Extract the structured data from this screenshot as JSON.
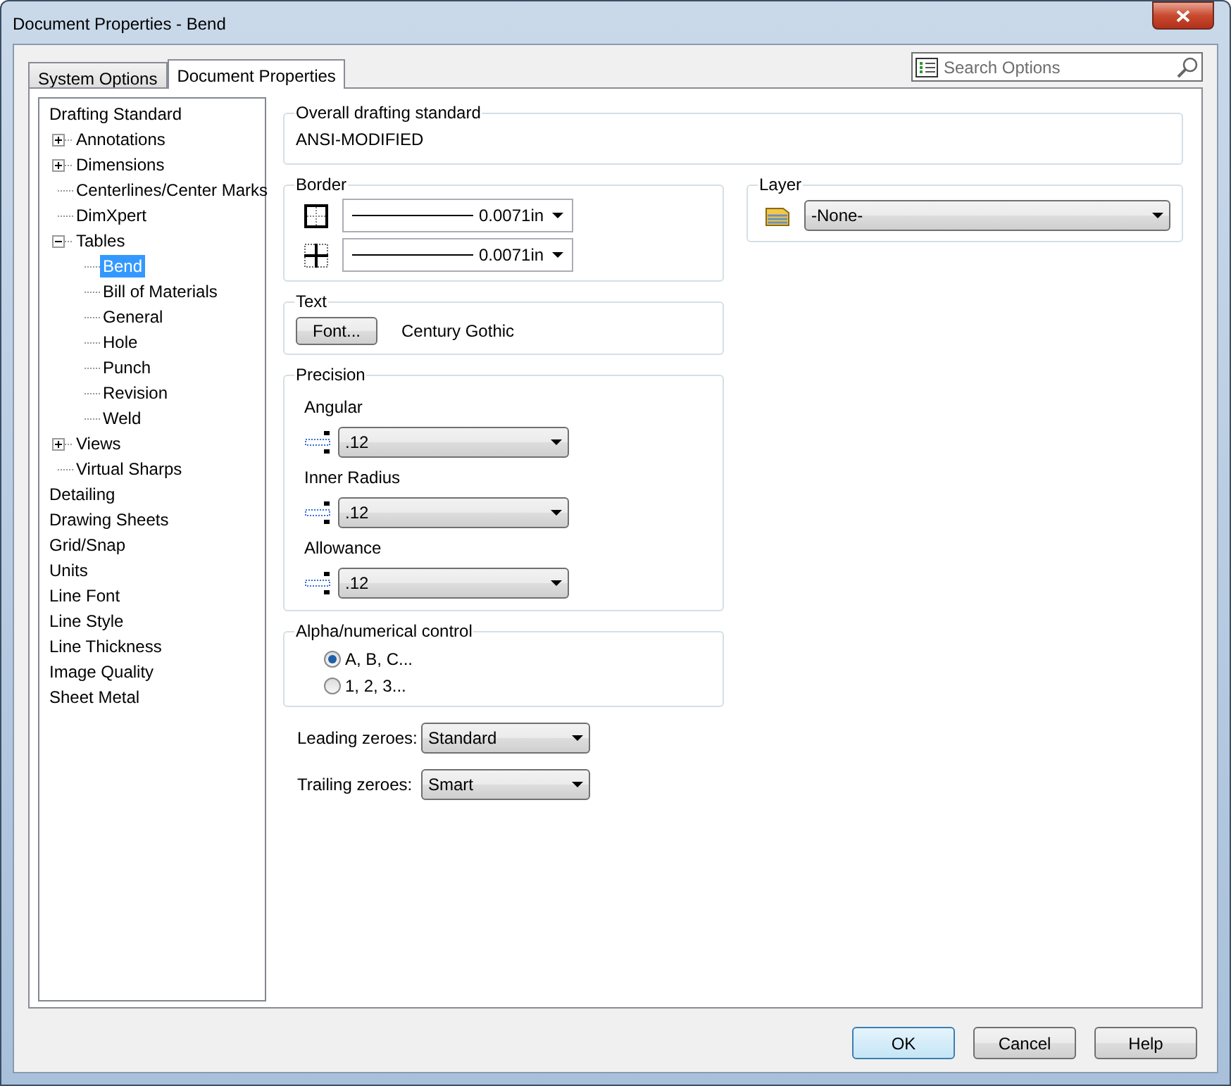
{
  "window": {
    "title": "Document Properties - Bend"
  },
  "tabs": [
    {
      "label": "System Options",
      "selected": false
    },
    {
      "label": "Document Properties",
      "selected": true
    }
  ],
  "search": {
    "placeholder": "Search Options"
  },
  "tree": [
    {
      "label": "Drafting Standard",
      "selected": false,
      "children": [
        {
          "label": "Annotations",
          "kind": "folder",
          "expanded": false,
          "selected": false
        },
        {
          "label": "Dimensions",
          "kind": "folder",
          "expanded": false,
          "selected": false
        },
        {
          "label": "Centerlines/Center Marks",
          "kind": "leaf",
          "selected": false
        },
        {
          "label": "DimXpert",
          "kind": "leaf",
          "selected": false
        },
        {
          "label": "Tables",
          "kind": "folder",
          "expanded": true,
          "selected": false,
          "children": [
            {
              "label": "Bend",
              "kind": "leaf",
              "selected": true
            },
            {
              "label": "Bill of Materials",
              "kind": "leaf",
              "selected": false
            },
            {
              "label": "General",
              "kind": "leaf",
              "selected": false
            },
            {
              "label": "Hole",
              "kind": "leaf",
              "selected": false
            },
            {
              "label": "Punch",
              "kind": "leaf",
              "selected": false
            },
            {
              "label": "Revision",
              "kind": "leaf",
              "selected": false
            },
            {
              "label": "Weld",
              "kind": "leaf",
              "selected": false
            }
          ]
        },
        {
          "label": "Views",
          "kind": "folder",
          "expanded": false,
          "selected": false
        },
        {
          "label": "Virtual Sharps",
          "kind": "leaf",
          "selected": false
        }
      ]
    },
    {
      "label": "Detailing",
      "selected": false
    },
    {
      "label": "Drawing Sheets",
      "selected": false
    },
    {
      "label": "Grid/Snap",
      "selected": false
    },
    {
      "label": "Units",
      "selected": false
    },
    {
      "label": "Line Font",
      "selected": false
    },
    {
      "label": "Line Style",
      "selected": false
    },
    {
      "label": "Line Thickness",
      "selected": false
    },
    {
      "label": "Image Quality",
      "selected": false
    },
    {
      "label": "Sheet Metal",
      "selected": false
    }
  ],
  "overall": {
    "legend": "Overall drafting standard",
    "value": "ANSI-MODIFIED"
  },
  "border": {
    "legend": "Border",
    "rows": [
      {
        "kind": "outer",
        "value": "0.0071in"
      },
      {
        "kind": "inner",
        "value": "0.0071in"
      }
    ]
  },
  "text": {
    "legend": "Text",
    "button": "Font...",
    "font": "Century Gothic"
  },
  "precision": {
    "legend": "Precision",
    "rows": [
      {
        "label": "Angular",
        "value": ".12"
      },
      {
        "label": "Inner Radius",
        "value": ".12"
      },
      {
        "label": "Allowance",
        "value": ".12"
      }
    ]
  },
  "alpha": {
    "legend": "Alpha/numerical control",
    "options": [
      {
        "label": "A, B, C...",
        "selected": true
      },
      {
        "label": "1, 2, 3...",
        "selected": false
      }
    ]
  },
  "zeroes": [
    {
      "label": "Leading zeroes:",
      "value": "Standard"
    },
    {
      "label": "Trailing zeroes:",
      "value": "Smart"
    }
  ],
  "layer": {
    "legend": "Layer",
    "value": "-None-"
  },
  "buttons": [
    {
      "label": "OK",
      "default": true
    },
    {
      "label": "Cancel",
      "default": false
    },
    {
      "label": "Help",
      "default": false
    }
  ]
}
